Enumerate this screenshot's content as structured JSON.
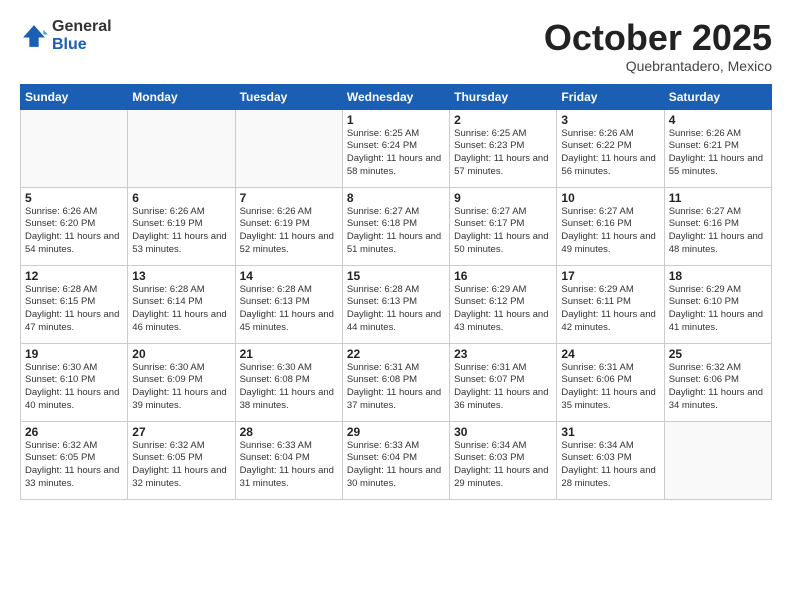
{
  "logo": {
    "general": "General",
    "blue": "Blue"
  },
  "header": {
    "month": "October 2025",
    "location": "Quebrantadero, Mexico"
  },
  "weekdays": [
    "Sunday",
    "Monday",
    "Tuesday",
    "Wednesday",
    "Thursday",
    "Friday",
    "Saturday"
  ],
  "weeks": [
    [
      {
        "day": "",
        "info": ""
      },
      {
        "day": "",
        "info": ""
      },
      {
        "day": "",
        "info": ""
      },
      {
        "day": "1",
        "info": "Sunrise: 6:25 AM\nSunset: 6:24 PM\nDaylight: 11 hours\nand 58 minutes."
      },
      {
        "day": "2",
        "info": "Sunrise: 6:25 AM\nSunset: 6:23 PM\nDaylight: 11 hours\nand 57 minutes."
      },
      {
        "day": "3",
        "info": "Sunrise: 6:26 AM\nSunset: 6:22 PM\nDaylight: 11 hours\nand 56 minutes."
      },
      {
        "day": "4",
        "info": "Sunrise: 6:26 AM\nSunset: 6:21 PM\nDaylight: 11 hours\nand 55 minutes."
      }
    ],
    [
      {
        "day": "5",
        "info": "Sunrise: 6:26 AM\nSunset: 6:20 PM\nDaylight: 11 hours\nand 54 minutes."
      },
      {
        "day": "6",
        "info": "Sunrise: 6:26 AM\nSunset: 6:19 PM\nDaylight: 11 hours\nand 53 minutes."
      },
      {
        "day": "7",
        "info": "Sunrise: 6:26 AM\nSunset: 6:19 PM\nDaylight: 11 hours\nand 52 minutes."
      },
      {
        "day": "8",
        "info": "Sunrise: 6:27 AM\nSunset: 6:18 PM\nDaylight: 11 hours\nand 51 minutes."
      },
      {
        "day": "9",
        "info": "Sunrise: 6:27 AM\nSunset: 6:17 PM\nDaylight: 11 hours\nand 50 minutes."
      },
      {
        "day": "10",
        "info": "Sunrise: 6:27 AM\nSunset: 6:16 PM\nDaylight: 11 hours\nand 49 minutes."
      },
      {
        "day": "11",
        "info": "Sunrise: 6:27 AM\nSunset: 6:16 PM\nDaylight: 11 hours\nand 48 minutes."
      }
    ],
    [
      {
        "day": "12",
        "info": "Sunrise: 6:28 AM\nSunset: 6:15 PM\nDaylight: 11 hours\nand 47 minutes."
      },
      {
        "day": "13",
        "info": "Sunrise: 6:28 AM\nSunset: 6:14 PM\nDaylight: 11 hours\nand 46 minutes."
      },
      {
        "day": "14",
        "info": "Sunrise: 6:28 AM\nSunset: 6:13 PM\nDaylight: 11 hours\nand 45 minutes."
      },
      {
        "day": "15",
        "info": "Sunrise: 6:28 AM\nSunset: 6:13 PM\nDaylight: 11 hours\nand 44 minutes."
      },
      {
        "day": "16",
        "info": "Sunrise: 6:29 AM\nSunset: 6:12 PM\nDaylight: 11 hours\nand 43 minutes."
      },
      {
        "day": "17",
        "info": "Sunrise: 6:29 AM\nSunset: 6:11 PM\nDaylight: 11 hours\nand 42 minutes."
      },
      {
        "day": "18",
        "info": "Sunrise: 6:29 AM\nSunset: 6:10 PM\nDaylight: 11 hours\nand 41 minutes."
      }
    ],
    [
      {
        "day": "19",
        "info": "Sunrise: 6:30 AM\nSunset: 6:10 PM\nDaylight: 11 hours\nand 40 minutes."
      },
      {
        "day": "20",
        "info": "Sunrise: 6:30 AM\nSunset: 6:09 PM\nDaylight: 11 hours\nand 39 minutes."
      },
      {
        "day": "21",
        "info": "Sunrise: 6:30 AM\nSunset: 6:08 PM\nDaylight: 11 hours\nand 38 minutes."
      },
      {
        "day": "22",
        "info": "Sunrise: 6:31 AM\nSunset: 6:08 PM\nDaylight: 11 hours\nand 37 minutes."
      },
      {
        "day": "23",
        "info": "Sunrise: 6:31 AM\nSunset: 6:07 PM\nDaylight: 11 hours\nand 36 minutes."
      },
      {
        "day": "24",
        "info": "Sunrise: 6:31 AM\nSunset: 6:06 PM\nDaylight: 11 hours\nand 35 minutes."
      },
      {
        "day": "25",
        "info": "Sunrise: 6:32 AM\nSunset: 6:06 PM\nDaylight: 11 hours\nand 34 minutes."
      }
    ],
    [
      {
        "day": "26",
        "info": "Sunrise: 6:32 AM\nSunset: 6:05 PM\nDaylight: 11 hours\nand 33 minutes."
      },
      {
        "day": "27",
        "info": "Sunrise: 6:32 AM\nSunset: 6:05 PM\nDaylight: 11 hours\nand 32 minutes."
      },
      {
        "day": "28",
        "info": "Sunrise: 6:33 AM\nSunset: 6:04 PM\nDaylight: 11 hours\nand 31 minutes."
      },
      {
        "day": "29",
        "info": "Sunrise: 6:33 AM\nSunset: 6:04 PM\nDaylight: 11 hours\nand 30 minutes."
      },
      {
        "day": "30",
        "info": "Sunrise: 6:34 AM\nSunset: 6:03 PM\nDaylight: 11 hours\nand 29 minutes."
      },
      {
        "day": "31",
        "info": "Sunrise: 6:34 AM\nSunset: 6:03 PM\nDaylight: 11 hours\nand 28 minutes."
      },
      {
        "day": "",
        "info": ""
      }
    ]
  ]
}
